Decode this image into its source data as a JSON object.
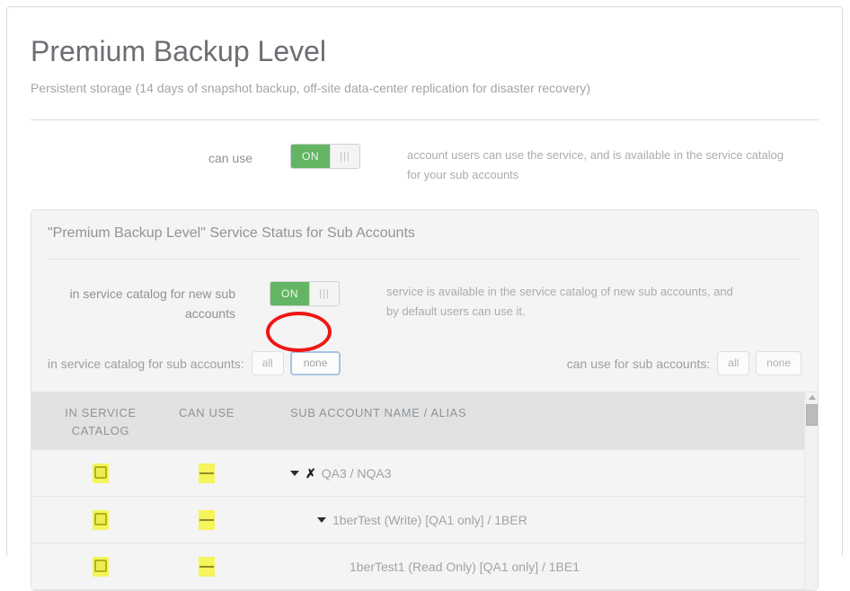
{
  "header": {
    "title": "Premium Backup Level",
    "subtitle": "Persistent storage (14 days of snapshot backup, off-site data-center replication for disaster recovery)"
  },
  "can_use_row": {
    "label": "can use",
    "switch_state": "ON",
    "grip_icon": "|||",
    "description": "account users can use the service, and is available in the service catalog for your sub accounts"
  },
  "sub_panel": {
    "title": "\"Premium Backup Level\" Service Status for Sub Accounts",
    "catalog_row": {
      "label": "in service catalog for new sub accounts",
      "switch_state": "ON",
      "grip_icon": "|||",
      "description": "service is available in the service catalog of new sub accounts, and by default users can use it."
    },
    "bulk": {
      "catalog_label": "in service catalog for sub accounts:",
      "catalog_all": "all",
      "catalog_none": "none",
      "canuse_label": "can use for sub accounts:",
      "canuse_all": "all",
      "canuse_none": "none"
    },
    "table": {
      "columns": {
        "catalog": "IN SERVICE CATALOG",
        "can_use": "CAN USE",
        "name": "SUB ACCOUNT NAME / ALIAS"
      },
      "rows": [
        {
          "catalog_state": "checked-box",
          "can_use_state": "indeterminate-line",
          "has_caret": true,
          "has_xmark": true,
          "indent": 0,
          "name": "QA3 / NQA3"
        },
        {
          "catalog_state": "checked-box",
          "can_use_state": "indeterminate-line",
          "has_caret": true,
          "has_xmark": false,
          "indent": 1,
          "name": "1berTest (Write) [QA1 only] / 1BER"
        },
        {
          "catalog_state": "checked-box",
          "can_use_state": "indeterminate-line",
          "has_caret": false,
          "has_xmark": false,
          "indent": 2,
          "name": "1berTest1 (Read Only) [QA1 only] / 1BE1"
        }
      ]
    }
  },
  "annotation": {
    "shape": "red-ellipse",
    "color": "#f01616",
    "targets": "catalog none button"
  },
  "colors": {
    "switch_on": "#63b563",
    "state_box": "#f5f45a",
    "annotation": "#f01616",
    "focus_border": "#a9c4e4"
  }
}
